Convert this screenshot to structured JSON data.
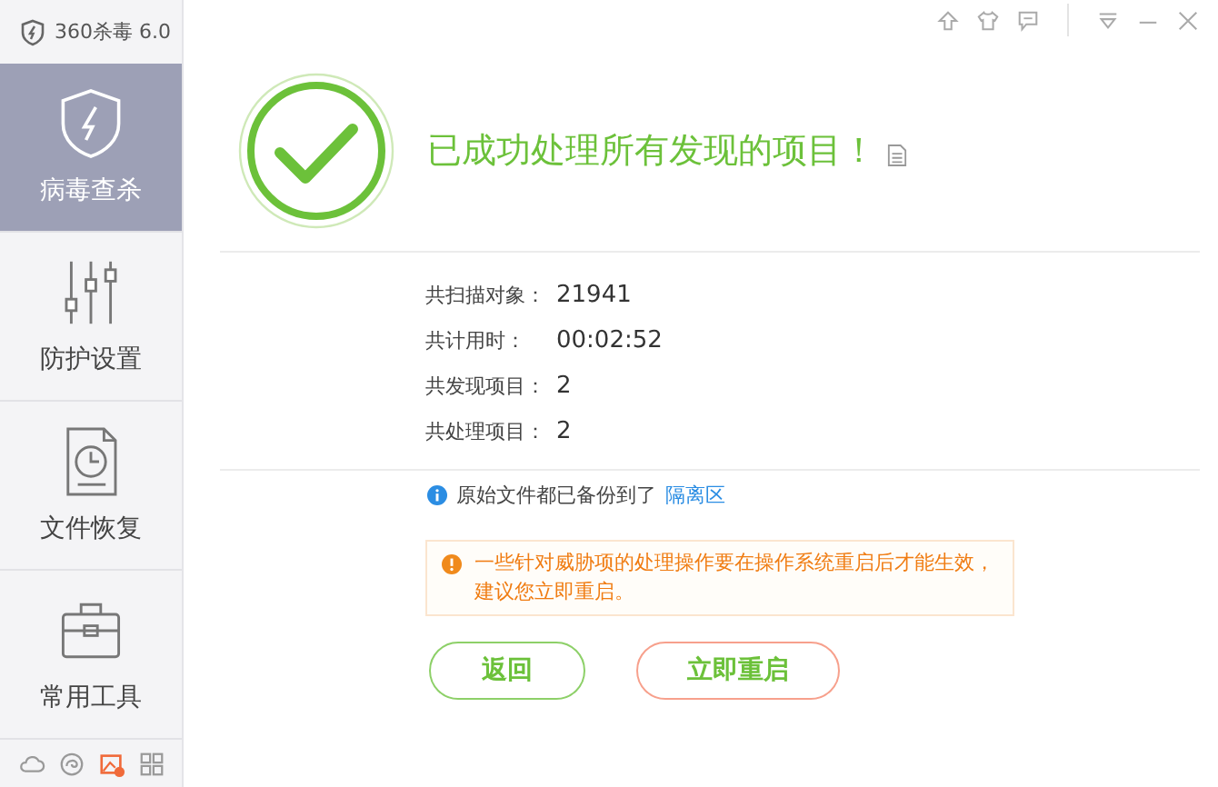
{
  "app_title": "360杀毒 6.0",
  "sidebar": {
    "items": [
      {
        "label": "病毒查杀",
        "selected": true,
        "kind": "shield"
      },
      {
        "label": "防护设置",
        "selected": false,
        "kind": "sliders"
      },
      {
        "label": "文件恢复",
        "selected": false,
        "kind": "restore"
      },
      {
        "label": "常用工具",
        "selected": false,
        "kind": "toolbox"
      }
    ]
  },
  "result": {
    "title": "已成功处理所有发现的项目！",
    "stats": [
      {
        "label": "共扫描对象：",
        "value": "21941"
      },
      {
        "label": "共计用时：",
        "value": "00:02:52"
      },
      {
        "label": "共发现项目：",
        "value": "2"
      },
      {
        "label": "共处理项目：",
        "value": "2"
      }
    ],
    "info": {
      "text": "原始文件都已备份到了",
      "link": "隔离区"
    },
    "warning": "一些针对威胁项的处理操作要在操作系统重启后才能生效，建议您立即重启。"
  },
  "buttons": [
    {
      "label": "返回",
      "kind": "back"
    },
    {
      "label": "立即重启",
      "kind": "restart"
    }
  ]
}
